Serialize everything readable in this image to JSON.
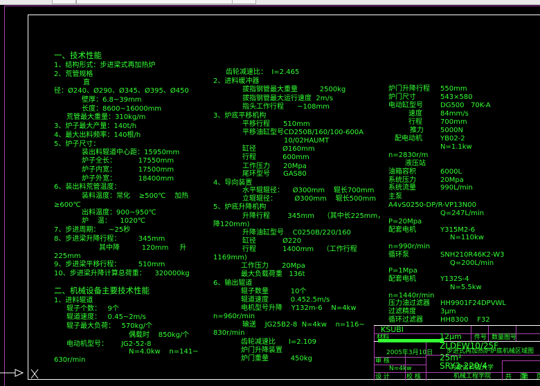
{
  "left": [
    "一、技术性能",
    "1、结构形式：步进梁式再加热炉",
    "2、荒管规格",
    "直",
    "径：Ø240、Ø290、Ø345、Ø395、Ø450",
    "壁厚：6.8~39mm",
    "长度：8600~16000mm",
    "荒管最大重量：310kg/m",
    "3、炉子最大产量：140t/h",
    "4、最大出料频率：140根/h",
    "5、炉子尺寸：",
    "装出料辊道中心距：15950mm",
    "炉子全长：          17550mm",
    "炉子内宽：          17500mm",
    "炉子外宽：          18400mm",
    "6、装出料荒管温度：",
    "装料温度：常化    ≥500℃    加热",
    "≥600℃",
    "出料温度：900~950℃",
    "炉    温：    1020℃",
    "7、步进周期：    ~25秒",
    "8、步进梁升降行程：        345mm",
    "其中降          120mm     升",
    "225mm",
    "9、步进梁平移行程：        510mm",
    "10、步进梁升降计算总荷重：    320000kg",
    "二、机械设备主要技术性能",
    "1、进料辊道",
    "辊子个数：   9个",
    "辊道速度：   0.45~2m/s",
    "辊子最大负荷：   570kg/个",
    "偶载时    850kg/个",
    "电动机型号：      JG2-52-8",
    "N=4.0kw    n=141~",
    "630r/min"
  ],
  "middle": [
    "齿轮减速比：  I=2.465",
    "2、进料缓冲器",
    "拔指钢管最大重量          2500kg",
    "拔指钢管最大运行速度  2m/s",
    "指头工作行程      ~108mm",
    "3、炉底平移机构",
    "平移行程      510mm",
    "平移油缸型号CD250B/160/100-600A",
    "10/02HAUMT",
    "缸径            Ø160mm",
    "行程            600mm",
    "工作压力      20Mpa",
    "尾环型号      GAS80",
    "4、导向装置",
    "水平辊辊径：    Ø300mm    辊长700mm",
    "立辊辊径：        Ø300mm    辊长500mm",
    "5、炉底升降机构",
    "升降行程        345mm    （其中长225mm，",
    "降120mm)",
    "升降油缸型号    C0250B/220/160",
    "缸径            Ø220",
    "行程            1400mm    （工作行程",
    "1169mm)",
    "工作压力      20Mpa",
    "最大负载荷重   136t",
    "6、输出辊道",
    "辊子数量          10个",
    "辊道速度          0.452.5m/s",
    "电机型号升降    Y132m-6    N=4kw",
    "n=960r/min",
    "输送    JG25B2-8  N=4kw    n=116~",
    "830r/min",
    "齿轮减速比      I=2.109",
    "炉门升降装置",
    "炉门重量          450kg"
  ],
  "right": [
    [
      "炉门升降行程",
      "550mm"
    ],
    [
      "炉门尺寸",
      "543×580"
    ],
    [
      "电动缸型号",
      "DG500   70K-A"
    ],
    [
      "速度",
      "84mm/s"
    ],
    [
      "行程",
      "700mm"
    ],
    [
      "推力",
      "5000N"
    ],
    [
      "配电动机",
      "YB02-2"
    ],
    [
      "",
      "N=1.1kw"
    ],
    [
      "n=2830r/m",
      ""
    ],
    [
      "液压站",
      ""
    ],
    [
      "油箱容积",
      "6000L"
    ],
    [
      "系统压力",
      "20Mpa"
    ],
    [
      "系统流量",
      "990L/min"
    ],
    [
      "主泵",
      ""
    ],
    [
      "A4vS0250-DP/R-VP13N00",
      ""
    ],
    [
      "",
      "Q=247L/min"
    ],
    [
      "P=20Mpa",
      ""
    ],
    [
      "配套电机",
      "Y315M2-6"
    ],
    [
      "",
      "N=110kw"
    ],
    [
      "n=990r/min",
      ""
    ],
    [
      "循环泵",
      "SNH210R46K2-W3"
    ],
    [
      "",
      "Q=200L/min"
    ],
    [
      "P=1Mpa",
      ""
    ],
    [
      "配套电机",
      "Y132S-4"
    ],
    [
      "",
      "N=5.5kw"
    ],
    [
      "n=1440r/min",
      ""
    ],
    [
      "压力油过滤器",
      "HH9901F24DPVWL"
    ],
    [
      "过滤精度",
      "3μm"
    ],
    [
      "循环过滤器",
      "HH8300    F32"
    ]
  ],
  "title_block": {
    "code": "KSUBI",
    "material": "材料",
    "part_no": "件号",
    "drawing_no": "数量图号",
    "filter": "12μm",
    "model": "ZLDEW10/25F",
    "drawing_title": "步进式再加热炉炉底机械区域图",
    "date": "2005年3月10日",
    "area": "25m²",
    "pump": "SRY2-220/4",
    "school": "内蒙古科技大学",
    "college": "机械工程学院",
    "power": "N=4kw",
    "design": "设 计",
    "check": "校 核",
    "review": "审 核",
    "total_pages": "共    页",
    "page": "第    页"
  },
  "ucs_label": "X",
  "colors": {
    "text": "#33ff33",
    "frame": "#ffffff",
    "border": "#b040b0"
  }
}
